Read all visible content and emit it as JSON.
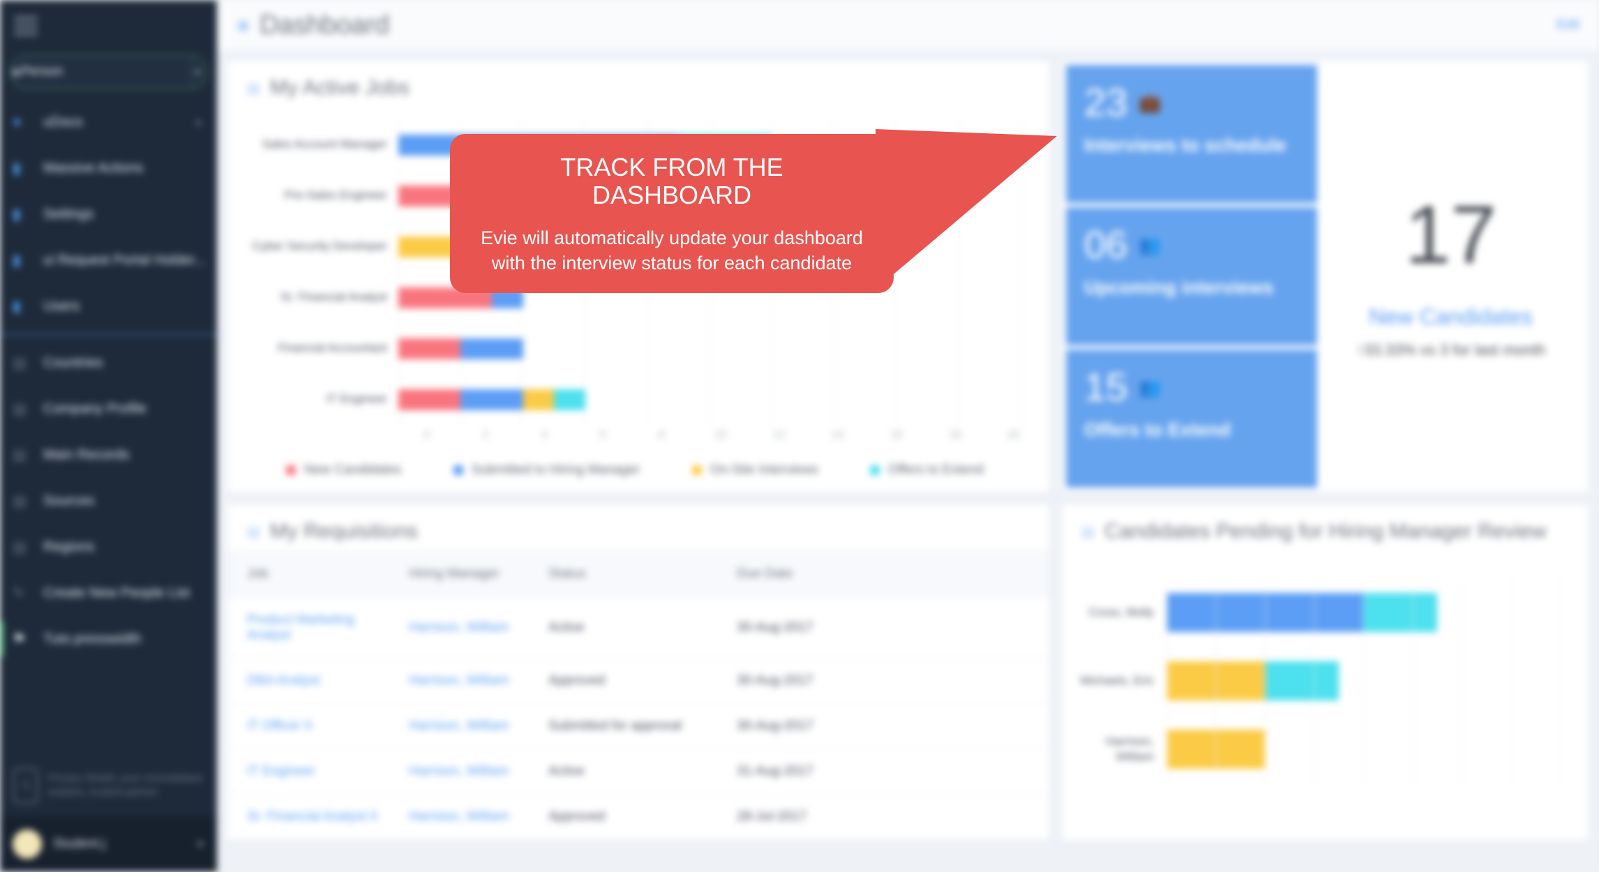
{
  "sidebar": {
    "search": {
      "value": "Person",
      "placeholder": "Person",
      "icon": "search-icon",
      "dropdown_icon": "chevron-down-icon"
    },
    "items": [
      {
        "label": "uDocs",
        "icon": "person-icon",
        "has_chevron": true
      },
      {
        "label": "Massive Actions",
        "icon": "folder-icon"
      },
      {
        "label": "Settings",
        "icon": "folder-icon"
      },
      {
        "label": "ui Request Portal Holder...",
        "icon": "folder-icon"
      },
      {
        "label": "Users",
        "icon": "folder-icon"
      },
      {
        "label": "Countries",
        "icon": "list-icon"
      },
      {
        "label": "Company Profile",
        "icon": "list-icon"
      },
      {
        "label": "Main Records",
        "icon": "list-icon"
      },
      {
        "label": "Sources",
        "icon": "list-icon"
      },
      {
        "label": "Regions",
        "icon": "list-icon"
      },
      {
        "label": "Create New People List",
        "icon": "pencil-icon"
      },
      {
        "label": "Tuto.presswidth",
        "icon": "flag-icon",
        "active": true
      }
    ],
    "promo": {
      "icon": "shield-icon",
      "text": "Privacy Shield, your consolidated\nsolution, trusted partner"
    },
    "user": {
      "name": "Student.j",
      "lock_icon": "lock-icon",
      "avatar": "avatar"
    }
  },
  "header": {
    "title": "Dashboard",
    "icon": "dashboard-icon",
    "link_label": "Edit"
  },
  "active_jobs": {
    "title": "My Active Jobs",
    "icon": "chart-icon"
  },
  "kpis": [
    {
      "value": "23",
      "label": "Interviews to schedule",
      "icon": "briefcase-icon"
    },
    {
      "value": "06",
      "label": "Upcoming interviews",
      "icon": "people-icon"
    },
    {
      "value": "15",
      "label": "Offers to Extend",
      "icon": "people-icon"
    }
  ],
  "new_candidates": {
    "value": "17",
    "label": "New Candidates",
    "delta": "↑33.33% vs 3 for last month"
  },
  "callout": {
    "title": "TRACK FROM THE DASHBOARD",
    "body": "Evie will automatically update your dashboard with the interview status for each candidate",
    "color": "#e8544f"
  },
  "requisitions": {
    "title": "My Requisitions",
    "icon": "list-icon",
    "columns": [
      "Job",
      "Hiring Manager",
      "Status",
      "Due Date"
    ],
    "rows": [
      {
        "job": "Product Marketing Analyst",
        "manager": "Harrison, William",
        "status": "Active",
        "due": "30-Aug-2017"
      },
      {
        "job": "DBA Analyst",
        "manager": "Harrison, William",
        "status": "Approved",
        "due": "30-Aug-2017"
      },
      {
        "job": "IT Officer II",
        "manager": "Harrison, William",
        "status": "Submitted for approval",
        "due": "30-Aug-2017"
      },
      {
        "job": "IT Engineer",
        "manager": "Harrison, William",
        "status": "Active",
        "due": "31-Aug-2017"
      },
      {
        "job": "Sr. Financial Analyst II",
        "manager": "Harrison, William",
        "status": "Approved",
        "due": "28-Jul-2017"
      }
    ]
  },
  "pending_review": {
    "title": "Candidates Pending for Hiring Manager Review",
    "icon": "chart-icon"
  },
  "chart_data": [
    {
      "type": "bar",
      "id": "my-active-jobs",
      "orientation": "horizontal",
      "stacked": true,
      "title": "My Active Jobs",
      "xlabel": "",
      "ylabel": "",
      "xlim": [
        0,
        20
      ],
      "grid": true,
      "legend_position": "bottom",
      "categories": [
        "Sales Account Manager",
        "Pre-Sales Engineer",
        "Cyber Security Developer",
        "Sr. Financial Analyst",
        "Financial Accountant",
        "IT Engineer"
      ],
      "series": [
        {
          "name": "New Candidates",
          "color": "#f9757e",
          "values": [
            0,
            2,
            0,
            3,
            2,
            2
          ]
        },
        {
          "name": "Submitted to Hiring Manager",
          "color": "#5c9df5",
          "values": [
            9,
            0,
            0,
            1,
            2,
            2
          ]
        },
        {
          "name": "On-Site Interviews",
          "color": "#fbcb46",
          "values": [
            0,
            0,
            3,
            0,
            0,
            1
          ]
        },
        {
          "name": "Offers to Extend",
          "color": "#4de0ee",
          "values": [
            3,
            0,
            0,
            0,
            0,
            1
          ]
        }
      ],
      "xticks": [
        "0",
        "2",
        "4",
        "6",
        "8",
        "10",
        "12",
        "14",
        "16",
        "18",
        "20"
      ]
    },
    {
      "type": "bar",
      "id": "candidates-pending-review",
      "orientation": "horizontal",
      "stacked": true,
      "title": "Candidates Pending for Hiring Manager Review",
      "xlabel": "",
      "ylabel": "",
      "grid": true,
      "legend_position": "none",
      "categories": [
        "Cross, Molly",
        "Michaels, Eric",
        "Harrison, William"
      ],
      "series": [
        {
          "name": "Submitted to Hiring Manager",
          "color": "#5c9df5",
          "values": [
            4,
            0,
            0
          ]
        },
        {
          "name": "On-Site Interviews",
          "color": "#fbcb46",
          "values": [
            0,
            2,
            2
          ]
        },
        {
          "name": "Offers to Extend",
          "color": "#4de0ee",
          "values": [
            1.5,
            1.5,
            0
          ]
        }
      ]
    }
  ]
}
